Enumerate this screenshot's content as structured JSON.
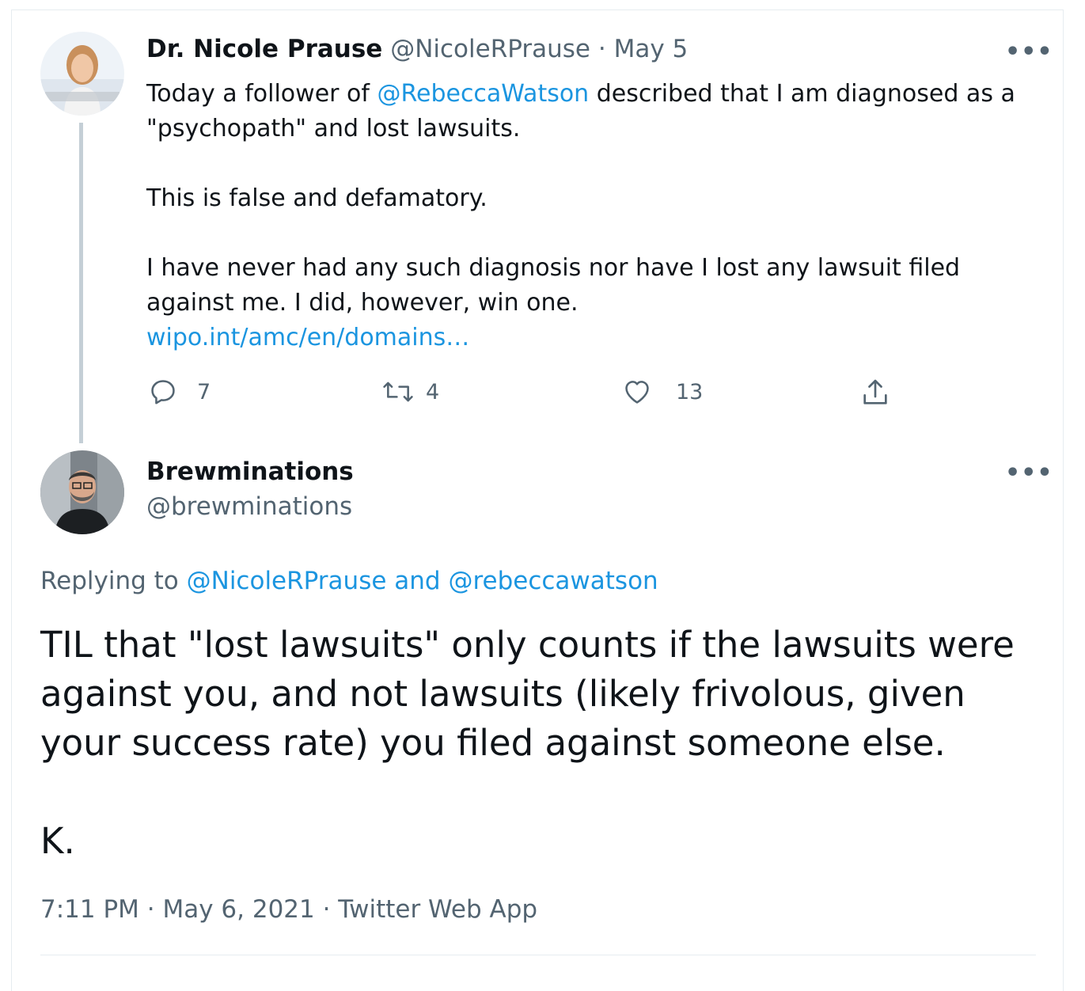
{
  "tweet1": {
    "author_name": "Dr. Nicole Prause",
    "author_handle": "@NicoleRPrause",
    "separator": " · ",
    "date": "May 5",
    "text_pre": "Today a follower of ",
    "mention": "@RebeccaWatson",
    "text_post": " described that I am diagnosed as a \"psychopath\" and lost lawsuits.",
    "para2": "This is false and defamatory.",
    "para3": "I have never had any such diagnosis nor have I lost any lawsuit filed against me. I did, however, win one.",
    "link": "wipo.int/amc/en/domains…",
    "replies": "7",
    "retweets": "4",
    "likes": "13",
    "more": "•••"
  },
  "tweet2": {
    "author_name": "Brewminations",
    "author_handle": "@brewminations",
    "more": "•••",
    "replying_label": "Replying to ",
    "replying_users": "@NicoleRPrause and @rebeccawatson",
    "para1": "TIL that \"lost lawsuits\" only counts if the lawsuits were against you, and not lawsuits (likely frivolous, given your success rate) you filed against someone else.",
    "para2": "K.",
    "meta": "7:11 PM · May 6, 2021 · Twitter Web App"
  },
  "colors": {
    "link": "#1b95e0",
    "muted": "#536471",
    "text": "#0f1419",
    "thread_line": "#c4cfd6"
  },
  "icons": [
    "reply-icon",
    "retweet-icon",
    "like-icon",
    "share-icon",
    "more-icon"
  ]
}
